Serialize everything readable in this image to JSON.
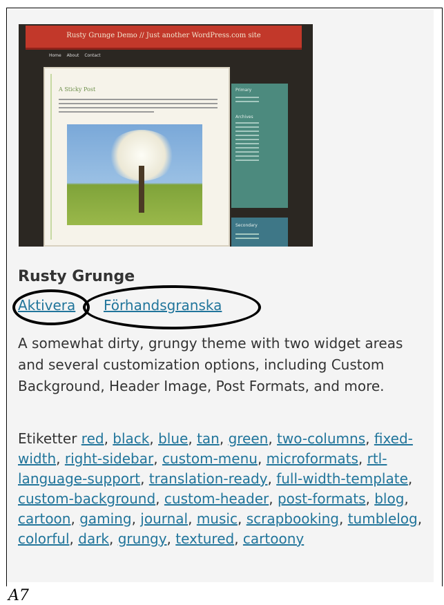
{
  "theme": {
    "screenshot": {
      "site_title": "Rusty Grunge Demo  // Just another WordPress.com site",
      "nav": [
        "Home",
        "About",
        "Contact"
      ],
      "post_title": "A Sticky Post",
      "sidebar_primary": "Primary",
      "sidebar_archives": "Archives",
      "sidebar_secondary": "Secondary"
    },
    "name": "Rusty Grunge",
    "actions": {
      "activate": "Aktivera",
      "preview": "Förhandsgranska"
    },
    "description": "A somewhat dirty, grungy theme with two widget areas and several customization options, including Custom Background, Header Image, Post Formats, and more.",
    "tags_label": "Etiketter",
    "tags": [
      "red",
      "black",
      "blue",
      "tan",
      "green",
      "two-columns",
      "fixed-width",
      "right-sidebar",
      "custom-menu",
      "microformats",
      "rtl-language-support",
      "translation-ready",
      "full-width-template",
      "custom-background",
      "custom-header",
      "post-formats",
      "blog",
      "cartoon",
      "gaming",
      "journal",
      "music",
      "scrapbooking",
      "tumblelog",
      "colorful",
      "dark",
      "grungy",
      "textured",
      "cartoony"
    ]
  },
  "figure_label": "A7",
  "colors": {
    "link": "#21759b",
    "text": "#333333",
    "panel": "#f4f4f4"
  }
}
